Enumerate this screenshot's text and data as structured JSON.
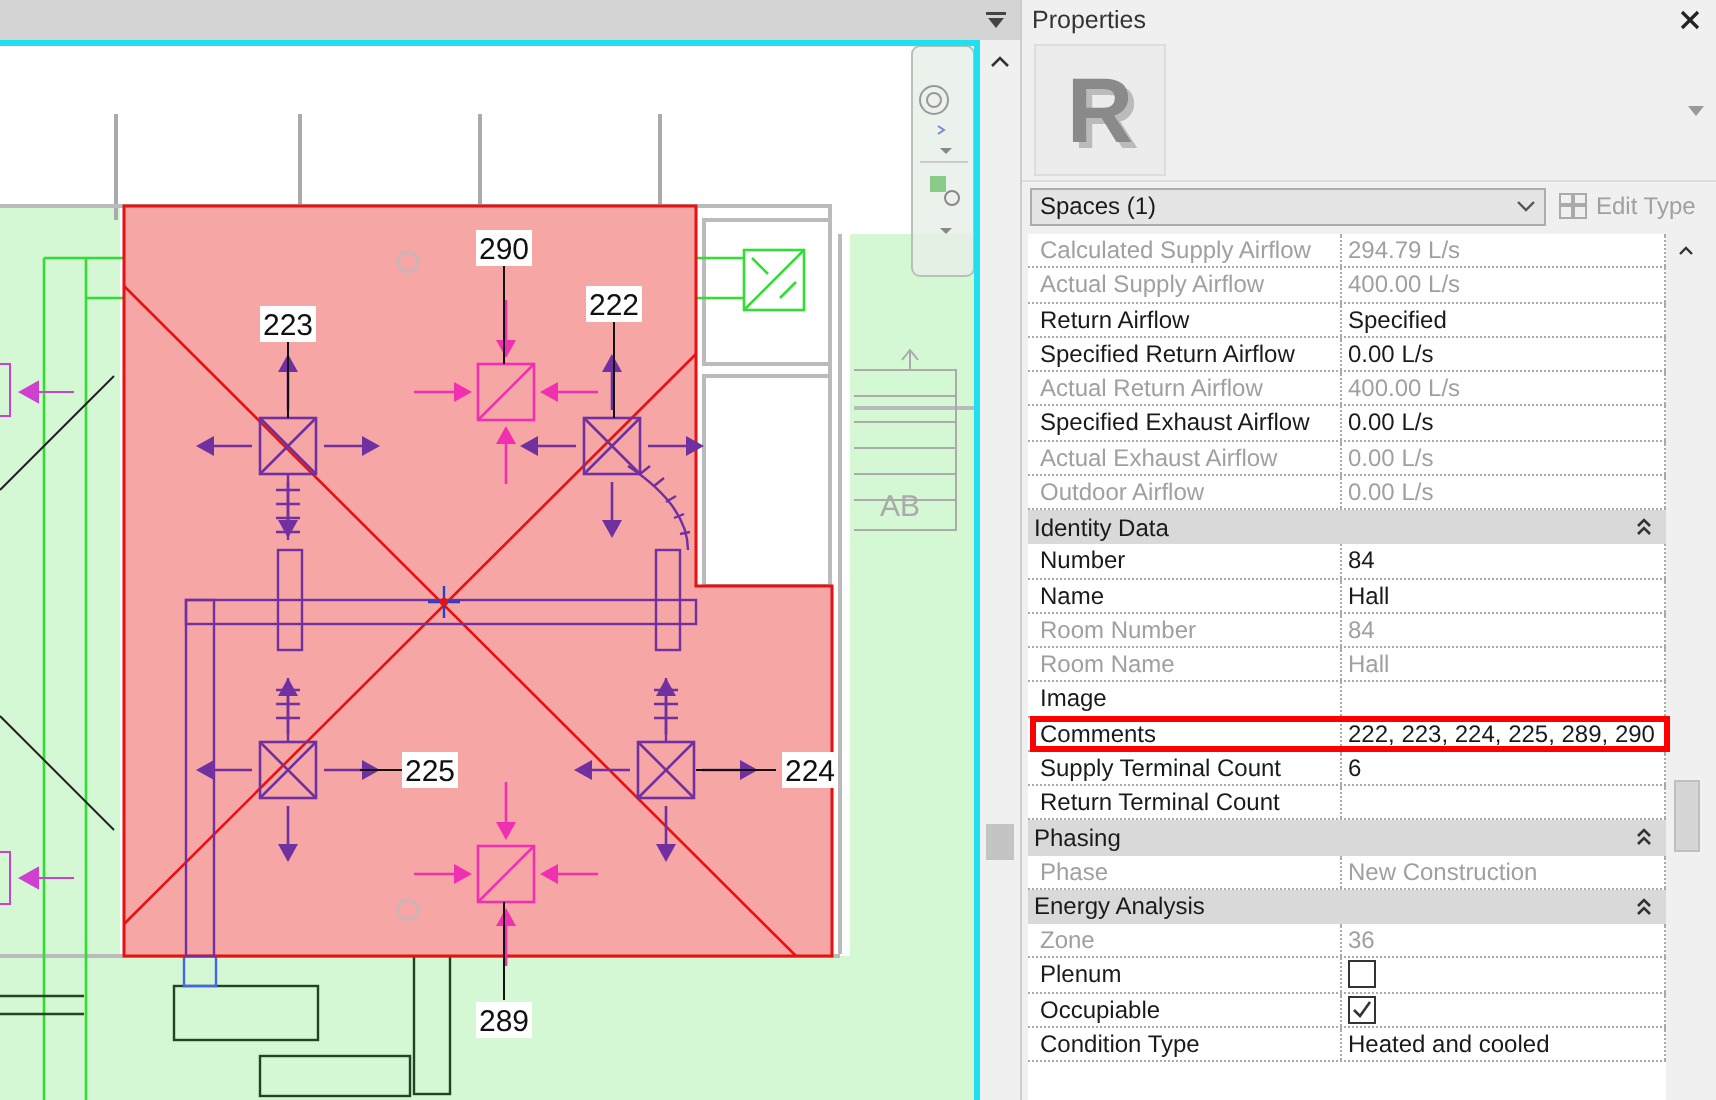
{
  "plan": {
    "tags": [
      {
        "label": "290"
      },
      {
        "label": "223"
      },
      {
        "label": "222"
      },
      {
        "label": "225"
      },
      {
        "label": "224"
      },
      {
        "label": "289"
      }
    ],
    "stair_label": "AB"
  },
  "properties": {
    "title": "Properties",
    "type_image": {
      "letter": "R"
    },
    "type_selector": "Spaces (1)",
    "edit_type": {
      "label": "Edit Type",
      "disabled": true
    },
    "rows": [
      {
        "kind": "param",
        "label": "Calculated Supply Airflow",
        "value": "294.79 L/s",
        "read_only": true,
        "highlighted": false
      },
      {
        "kind": "param",
        "label": "Actual Supply Airflow",
        "value": "400.00 L/s",
        "read_only": true,
        "highlighted": false
      },
      {
        "kind": "param",
        "label": "Return Airflow",
        "value": "Specified",
        "read_only": false,
        "highlighted": false
      },
      {
        "kind": "param",
        "label": "Specified Return Airflow",
        "value": "0.00 L/s",
        "read_only": false,
        "highlighted": false
      },
      {
        "kind": "param",
        "label": "Actual Return Airflow",
        "value": "400.00 L/s",
        "read_only": true,
        "highlighted": false
      },
      {
        "kind": "param",
        "label": "Specified Exhaust Airflow",
        "value": "0.00 L/s",
        "read_only": false,
        "highlighted": false
      },
      {
        "kind": "param",
        "label": "Actual Exhaust Airflow",
        "value": "0.00 L/s",
        "read_only": true,
        "highlighted": false
      },
      {
        "kind": "param",
        "label": "Outdoor Airflow",
        "value": "0.00 L/s",
        "read_only": true,
        "highlighted": false
      },
      {
        "kind": "section",
        "label": "Identity Data",
        "expanded": true
      },
      {
        "kind": "param",
        "label": "Number",
        "value": "84",
        "read_only": false,
        "highlighted": false
      },
      {
        "kind": "param",
        "label": "Name",
        "value": "Hall",
        "read_only": false,
        "highlighted": false
      },
      {
        "kind": "param",
        "label": "Room Number",
        "value": "84",
        "read_only": true,
        "highlighted": false
      },
      {
        "kind": "param",
        "label": "Room Name",
        "value": "Hall",
        "read_only": true,
        "highlighted": false
      },
      {
        "kind": "param",
        "label": "Image",
        "read_only": false,
        "highlighted": false
      },
      {
        "kind": "param",
        "label": "Comments",
        "value": "222, 223, 224, 225, 289, 290",
        "read_only": false,
        "highlighted": true
      },
      {
        "kind": "param",
        "label": "Supply Terminal Count",
        "value": "6",
        "read_only": false,
        "highlighted": false
      },
      {
        "kind": "param",
        "label": "Return Terminal Count",
        "read_only": false,
        "highlighted": false
      },
      {
        "kind": "section",
        "label": "Phasing",
        "expanded": true
      },
      {
        "kind": "param",
        "label": "Phase",
        "value": "New Construction",
        "read_only": true,
        "highlighted": false
      },
      {
        "kind": "section",
        "label": "Energy Analysis",
        "expanded": true
      },
      {
        "kind": "param",
        "label": "Zone",
        "value": "36",
        "read_only": true,
        "highlighted": false
      },
      {
        "kind": "checkbox",
        "label": "Plenum",
        "checked": false,
        "read_only": false,
        "highlighted": false
      },
      {
        "kind": "checkbox",
        "label": "Occupiable",
        "checked": true,
        "read_only": false,
        "highlighted": false
      },
      {
        "kind": "param",
        "label": "Condition Type",
        "value": "Heated and cooled",
        "read_only": false,
        "highlighted": false
      }
    ]
  }
}
